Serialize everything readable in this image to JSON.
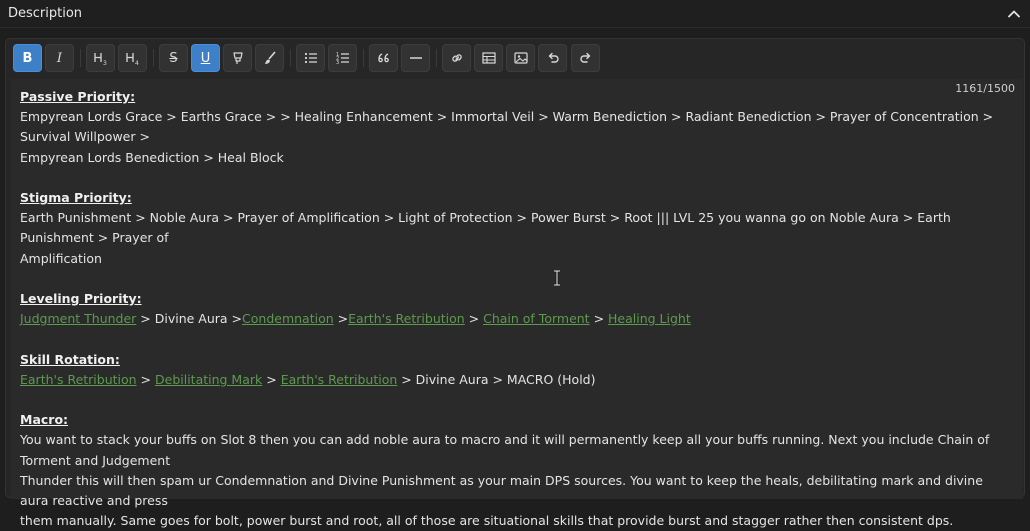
{
  "header": {
    "title": "Description",
    "collapse_icon": "chevron-up-icon"
  },
  "toolbar": {
    "buttons": [
      {
        "name": "bold-button",
        "label": "B",
        "active": true
      },
      {
        "name": "italic-button",
        "label": "I"
      },
      {
        "name": "heading3-button",
        "label": "H3"
      },
      {
        "name": "heading4-button",
        "label": "H4"
      },
      {
        "name": "strikethrough-button",
        "label": "S"
      },
      {
        "name": "underline-button",
        "label": "U",
        "active": true
      },
      {
        "name": "highlighter-button",
        "icon": "highlighter-icon"
      },
      {
        "name": "brush-button",
        "icon": "brush-icon"
      },
      {
        "name": "bullet-list-button",
        "icon": "bullet-list-icon"
      },
      {
        "name": "numbered-list-button",
        "icon": "numbered-list-icon"
      },
      {
        "name": "quote-button",
        "icon": "quote-icon"
      },
      {
        "name": "horizontal-rule-button",
        "icon": "minus-icon"
      },
      {
        "name": "link-button",
        "icon": "link-icon"
      },
      {
        "name": "table-button",
        "icon": "table-icon"
      },
      {
        "name": "image-button",
        "icon": "image-icon"
      },
      {
        "name": "undo-button",
        "icon": "undo-icon"
      },
      {
        "name": "redo-button",
        "icon": "redo-icon"
      }
    ]
  },
  "editor": {
    "char_count": "1161/1500",
    "passive": {
      "heading": "Passive Priority:",
      "line1": "Empyrean Lords Grace > Earths Grace > > Healing Enhancement > Immortal Veil > Warm Benediction > Radiant Benediction > Prayer of Concentration > Survival Willpower >",
      "line2": "Empyrean Lords Benediction > Heal Block"
    },
    "stigma": {
      "heading": "Stigma Priority:",
      "line1": "Earth Punishment > Noble Aura > Prayer of Amplification > Light of Protection > Power Burst > Root ||| LVL 25 you wanna go on Noble Aura > Earth Punishment > Prayer of",
      "line2": "Amplification"
    },
    "leveling": {
      "heading": "Leveling Priority:",
      "link1": "Judgment Thunder",
      "sep1": " > Divine Aura >",
      "link2": "Condemnation",
      "sep2": " >",
      "link3": "Earth's Retribution",
      "sep3": " > ",
      "link4": "Chain of Torment",
      "sep4": " > ",
      "link5": "Healing Light"
    },
    "rotation": {
      "heading": "Skill Rotation:",
      "link1": "Earth's Retribution",
      "sep1": " > ",
      "link2": "Debilitating Mark",
      "sep2": " > ",
      "link3": "Earth's Retribution",
      "tail": " > Divine Aura > MACRO (Hold)"
    },
    "macro": {
      "heading": "Macro:",
      "line1": "You want to stack your buffs on Slot 8 then you can add noble aura to macro and it will permanently keep all your buffs running. Next you include Chain of Torment and Judgement",
      "line2": "Thunder this will then spam ur Condemnation and Divine Punishment as your main DPS sources. You want to keep the heals, debilitating mark and divine aura reactive and press",
      "line3": "them manually. Same goes for bolt, power burst and root, all of those are situational skills that provide burst and stagger rather then consistent dps."
    }
  },
  "colors": {
    "active_button": "#3d80c8",
    "link": "#5c9a4e",
    "background": "#1e1e1e"
  }
}
